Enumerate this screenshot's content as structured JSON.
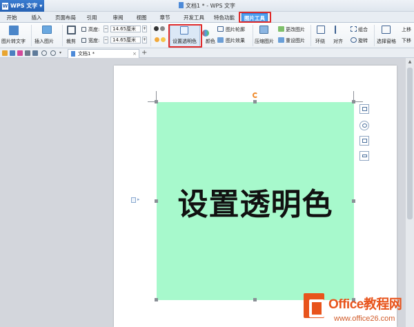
{
  "app": {
    "brand": "WPS 文字",
    "window_title": "文档1 * - WPS 文字"
  },
  "menu_tabs": [
    "开始",
    "插入",
    "页面布局",
    "引用",
    "审阅",
    "视图",
    "章节",
    "开发工具",
    "特色功能",
    "图片工具"
  ],
  "active_tab": "图片工具",
  "ribbon": {
    "pic_to_text": "图片转文字",
    "insert_pic": "插入图片",
    "crop": "裁剪",
    "height_label": "高度:",
    "height_value": "14.65厘米",
    "width_label": "宽度:",
    "width_value": "14.65厘米",
    "set_transparent": "设置透明色",
    "color": "颜色",
    "pic_outline": "图片轮廓",
    "pic_effect": "图片效果",
    "compress_pic": "压缩图片",
    "change_pic": "更改图片",
    "reset_pic": "重设图片",
    "wrap": "环绕",
    "align": "对齐",
    "group": "组合",
    "rotate": "旋转",
    "selection_pane": "选择窗格",
    "bring_forward": "上移",
    "send_backward": "下移"
  },
  "quick_toolbar": {
    "doc_tab": "文档1 *",
    "close": "×",
    "new_tab": "+"
  },
  "image": {
    "text": "设置透明色",
    "fill_color": "#a7f9cc"
  },
  "watermark": {
    "title": "Office教程网",
    "url": "www.office26.com"
  },
  "colors": {
    "active_tab": "#4b9ff0",
    "highlight_box": "#e02a2a",
    "accent_orange": "#e8541c"
  }
}
